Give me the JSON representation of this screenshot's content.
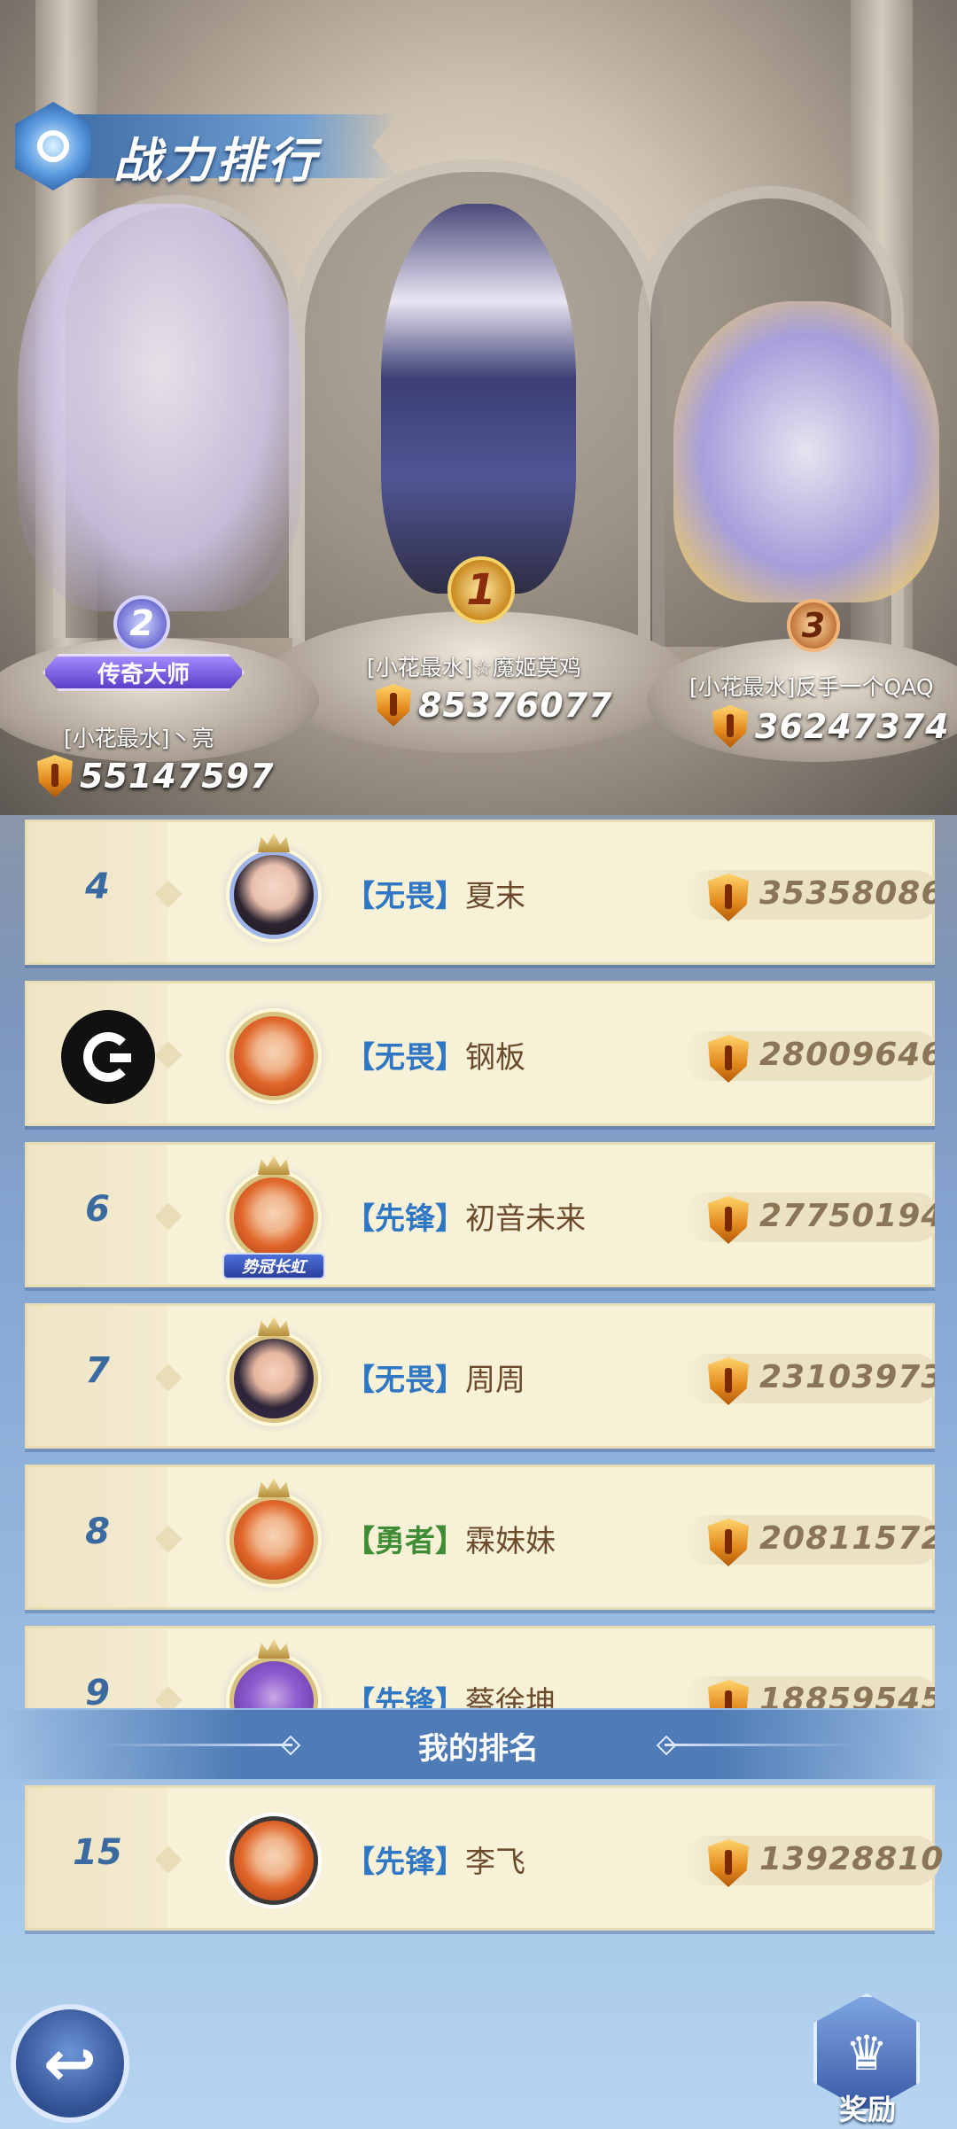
{
  "header": {
    "title": "战力排行"
  },
  "podium": [
    {
      "rank": "1",
      "name": "[小花最水]☆魔姬莫鸡",
      "power": "85376077"
    },
    {
      "rank": "2",
      "name": "[小花最水]丶亮",
      "power": "55147597",
      "badge": "传奇大师"
    },
    {
      "rank": "3",
      "name": "[小花最水]反手一个QAQ",
      "power": "36247374"
    }
  ],
  "list": [
    {
      "rank": "4",
      "guild": "【无畏】",
      "name": "夏末",
      "power": "35358086"
    },
    {
      "rank": "",
      "rank_icon": "guild-g-icon",
      "guild": "【无畏】",
      "name": "钢板",
      "power": "28009646"
    },
    {
      "rank": "6",
      "guild": "【先锋】",
      "name": "初音未来",
      "power": "27750194",
      "avatar_title": "势冠长虹"
    },
    {
      "rank": "7",
      "guild": "【无畏】",
      "name": "周周",
      "power": "23103973"
    },
    {
      "rank": "8",
      "guild": "【勇者】",
      "name": "霖妹妹",
      "power": "20811572"
    },
    {
      "rank": "9",
      "guild": "【先锋】",
      "name": "蔡徐坤",
      "power": "18859545"
    }
  ],
  "my_rank": {
    "header": "我的排名",
    "rank": "15",
    "guild": "【先锋】",
    "name": "李飞",
    "power": "13928810"
  },
  "buttons": {
    "back_icon": "back-arrow-icon",
    "reward_label": "奖励"
  },
  "colors": {
    "guild_blue": "#2f76c4",
    "guild_green": "#3f8d35",
    "row_bg": "#f7f1d7",
    "rank_num": "#3a6aa0"
  }
}
